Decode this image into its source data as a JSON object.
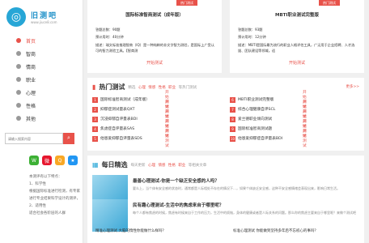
{
  "logo": {
    "title": "旧测吧",
    "subtitle": "www.jiuce8.com"
  },
  "nav": [
    {
      "label": "首页",
      "active": true,
      "icon": "home-icon"
    },
    {
      "label": "智商",
      "icon": "brain-icon"
    },
    {
      "label": "情商",
      "icon": "heart-icon"
    },
    {
      "label": "职业",
      "icon": "briefcase-icon"
    },
    {
      "label": "心理",
      "icon": "smile-icon"
    },
    {
      "label": "性格",
      "icon": "user-icon"
    },
    {
      "label": "其他",
      "icon": "more-icon"
    }
  ],
  "search": {
    "placeholder": "请输入搜索内容"
  },
  "social_icons": [
    "wechat-icon",
    "weibo-icon",
    "qq-icon",
    "qzone-icon"
  ],
  "sidebar_desc": "本测评有以下特点：\n1、科学性\n根据国际标准进行检测，有专家进行专业结果科学设计的测评，\n2、适用性\n适合社会各阶层的人群",
  "featured": [
    {
      "tag": "热门测试",
      "title": "国际标准智商测试（成年版）",
      "questions": "答题总数：90题",
      "time": "预计用时：40分钟",
      "desc": "描述：瑞文标准推理智商（IQ）是一种纯粹的非文字智力测验，是国际上广受认可的智力测验工具。【智商测",
      "button": "开始测试"
    },
    {
      "tag": "热门测试",
      "title": "MBTI职业测试完整版",
      "questions": "答题总数：93题",
      "time": "预计用时：12分钟",
      "desc": "描述：MBTI是国际最为流行的职业人格评估工具，广泛用于企业招聘、人才选拔、团队建设等领域。适",
      "button": "开始测试"
    }
  ],
  "hot": {
    "title": "热门测试",
    "sub_prefix": "精选",
    "sub_tags": [
      "心理",
      "情感",
      "性格",
      "职业"
    ],
    "sub_suffix": "等热门测试",
    "more": "更多>>",
    "left": [
      {
        "num": "1",
        "title": "国际标准智商测试（成年版）",
        "go": "开始测试"
      },
      {
        "num": "2",
        "title": "抑郁症测试量表QXT",
        "go": "开始测试"
      },
      {
        "num": "3",
        "title": "沉浸抑郁自评量表BDI",
        "go": "开始测试"
      },
      {
        "num": "4",
        "title": "焦虑症自评量表SAS",
        "go": "开始测试"
      },
      {
        "num": "5",
        "title": "他恩爱抑郁自评量表SDS",
        "go": "开始测试"
      }
    ],
    "right": [
      {
        "num": "6",
        "title": "MBTI职业测试完整版",
        "go": "开始测试"
      },
      {
        "num": "7",
        "title": "综合心理健康自评SCL",
        "go": "开始测试"
      },
      {
        "num": "8",
        "title": "爱兰德职业倾向测试",
        "go": "开始测试"
      },
      {
        "num": "9",
        "title": "国际标准智商测试题",
        "go": "开始测试"
      },
      {
        "num": "10",
        "title": "他恩爱抑郁症自评量表BDI",
        "go": "开始测试"
      }
    ]
  },
  "daily": {
    "title": "每日精选",
    "sub_prefix": "每天更新",
    "sub_tags": [
      "心理",
      "情感",
      "性格",
      "职业"
    ],
    "sub_suffix": "等相关文章",
    "items": [
      {
        "title": "最善心理测试-你是一个缺乏安全感的人吗？",
        "body": "要么上，当个体有安全感的状态时，通常都是人际相处不存在的情况下…，如果个体缺乏安全感，这种不安全感情绪会表现出来，影响日常生活。"
      },
      {
        "title": "民有趣心理测试-生活中的焦虑来自于哪里呢？",
        "body": "每个人都有焦虑的时候，焦虑有时候来自于工作的压力，生活中的烦恼，身体的健康或者是人际关系的问题。那么你的焦虑主要来自于哪里呢？来做个测试吧"
      }
    ],
    "bottom": [
      "精准心理测试 大脑的惰性你能做什么样吗？",
      "标准心理测试 你能做到坚持多年后不忘初心的事吗？"
    ]
  },
  "colors": {
    "accent": "#e8524a",
    "brand": "#27a6d6"
  }
}
